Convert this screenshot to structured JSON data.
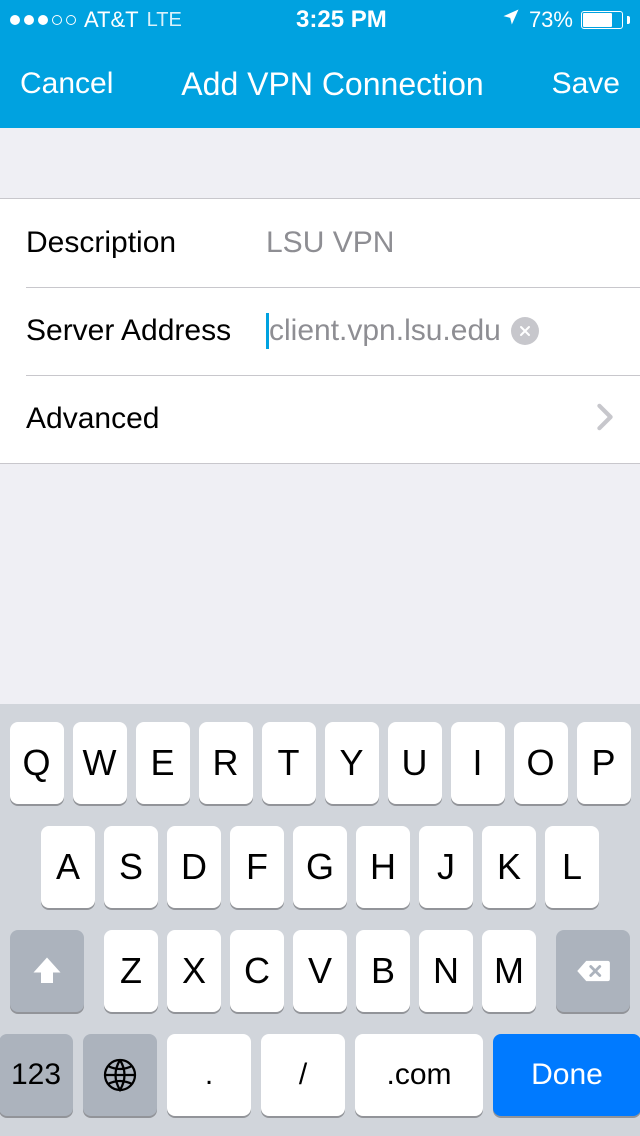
{
  "status": {
    "carrier": "AT&T",
    "network": "LTE",
    "time": "3:25 PM",
    "battery": "73%"
  },
  "nav": {
    "cancel": "Cancel",
    "title": "Add VPN Connection",
    "save": "Save"
  },
  "form": {
    "description_label": "Description",
    "description_value": "LSU VPN",
    "server_label": "Server Address",
    "server_value": "client.vpn.lsu.edu",
    "advanced_label": "Advanced"
  },
  "keyboard": {
    "row1": [
      "Q",
      "W",
      "E",
      "R",
      "T",
      "Y",
      "U",
      "I",
      "O",
      "P"
    ],
    "row2": [
      "A",
      "S",
      "D",
      "F",
      "G",
      "H",
      "J",
      "K",
      "L"
    ],
    "row3": [
      "Z",
      "X",
      "C",
      "V",
      "B",
      "N",
      "M"
    ],
    "numkey": "123",
    "dot": ".",
    "slash": "/",
    "com": ".com",
    "done": "Done"
  }
}
